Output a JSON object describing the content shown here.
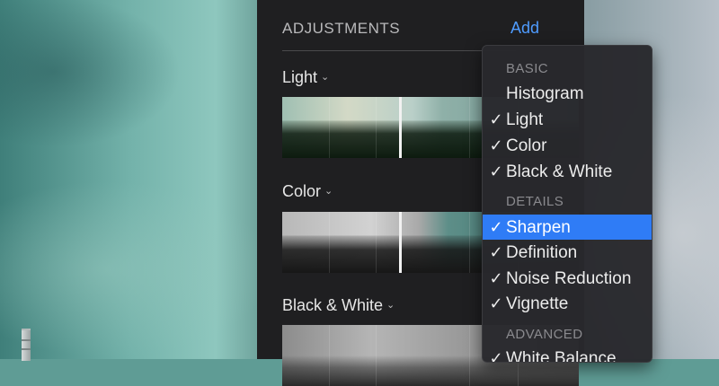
{
  "panel": {
    "title": "ADJUSTMENTS",
    "add_label": "Add",
    "sections": [
      {
        "label": "Light"
      },
      {
        "label": "Color"
      },
      {
        "label": "Black & White"
      }
    ]
  },
  "menu": {
    "groups": [
      {
        "label": "BASIC"
      },
      {
        "label": "DETAILS"
      },
      {
        "label": "ADVANCED"
      }
    ],
    "items": [
      {
        "label": "Histogram",
        "checked": false,
        "selected": false
      },
      {
        "label": "Light",
        "checked": true,
        "selected": false
      },
      {
        "label": "Color",
        "checked": true,
        "selected": false
      },
      {
        "label": "Black & White",
        "checked": true,
        "selected": false
      },
      {
        "label": "Sharpen",
        "checked": true,
        "selected": true
      },
      {
        "label": "Definition",
        "checked": true,
        "selected": false
      },
      {
        "label": "Noise Reduction",
        "checked": true,
        "selected": false
      },
      {
        "label": "Vignette",
        "checked": true,
        "selected": false
      },
      {
        "label": "White Balance",
        "checked": true,
        "selected": false
      }
    ],
    "check_glyph": "✓",
    "chevron_glyph": "⌄",
    "accent_color": "#2f7cf6",
    "add_color": "#4f9cff"
  }
}
